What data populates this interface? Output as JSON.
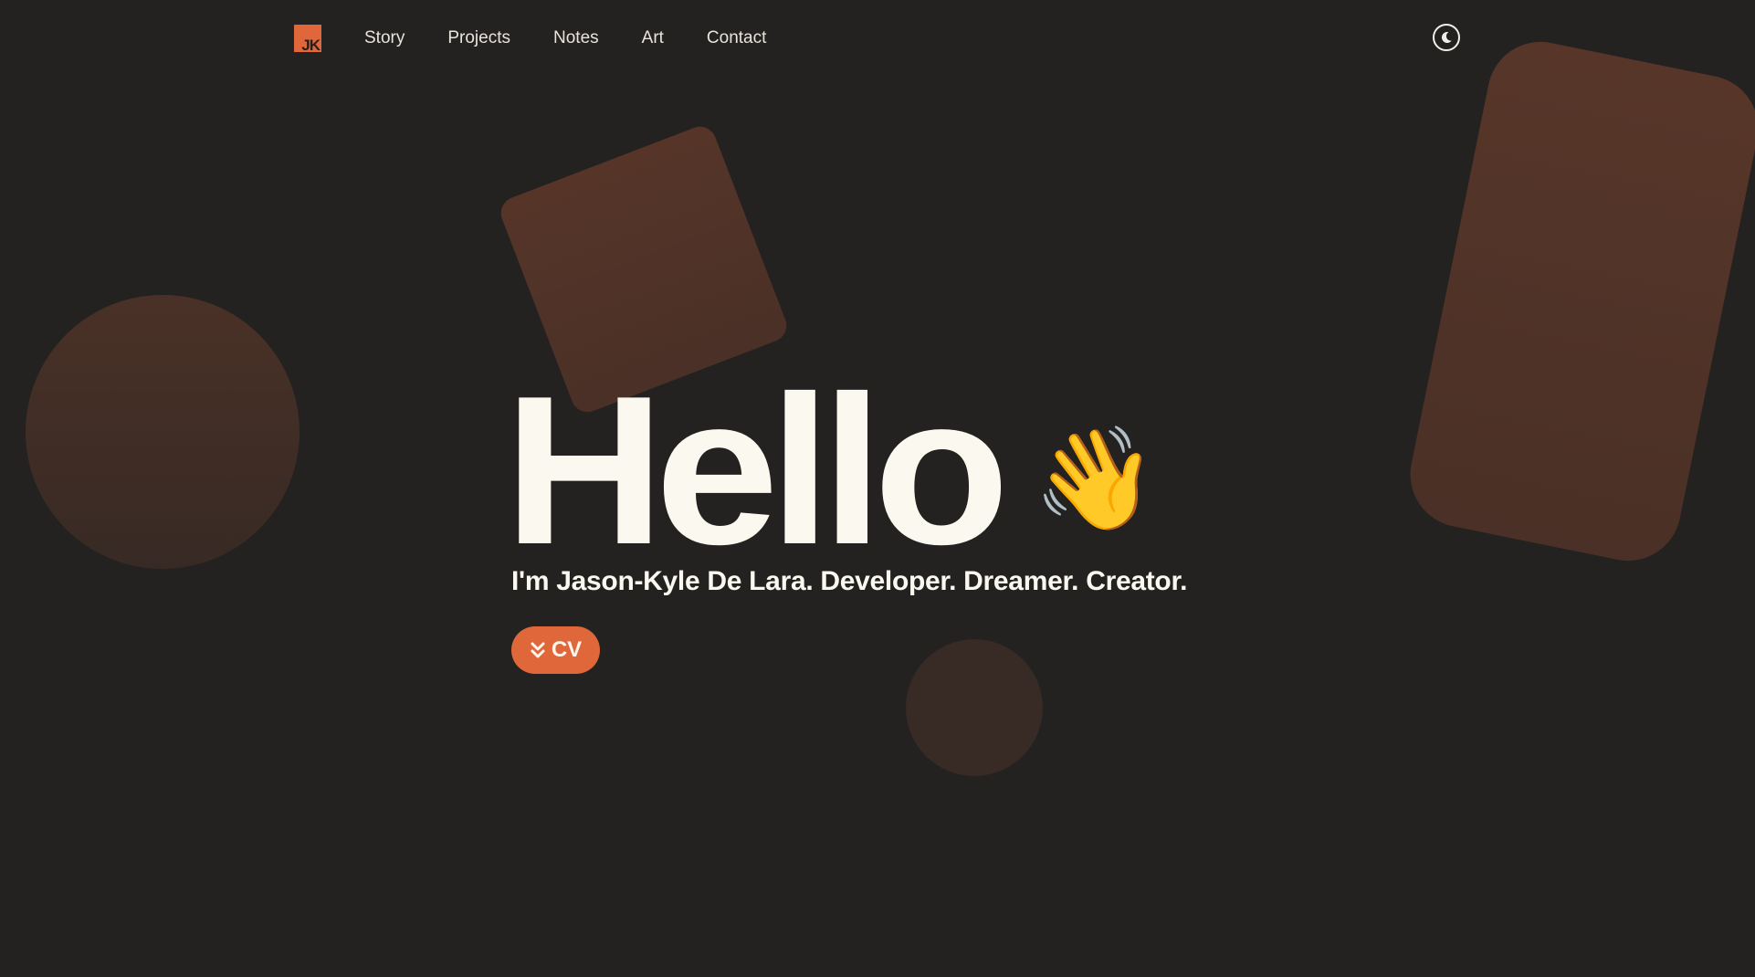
{
  "nav": {
    "logo_text": "JK",
    "links": [
      "Story",
      "Projects",
      "Notes",
      "Art",
      "Contact"
    ],
    "theme_toggle_icon": "moon-icon"
  },
  "hero": {
    "title": "Hello",
    "wave_emoji": "👋",
    "subtitle": "I'm Jason-Kyle De Lara. Developer.  Dreamer.  Creator.",
    "cv_button": {
      "label": "CV",
      "icon": "chevrons-down-icon"
    }
  },
  "colors": {
    "background": "#232221",
    "accent": "#e0673a",
    "text": "#fbf8ef",
    "shape": "#4f3327"
  }
}
